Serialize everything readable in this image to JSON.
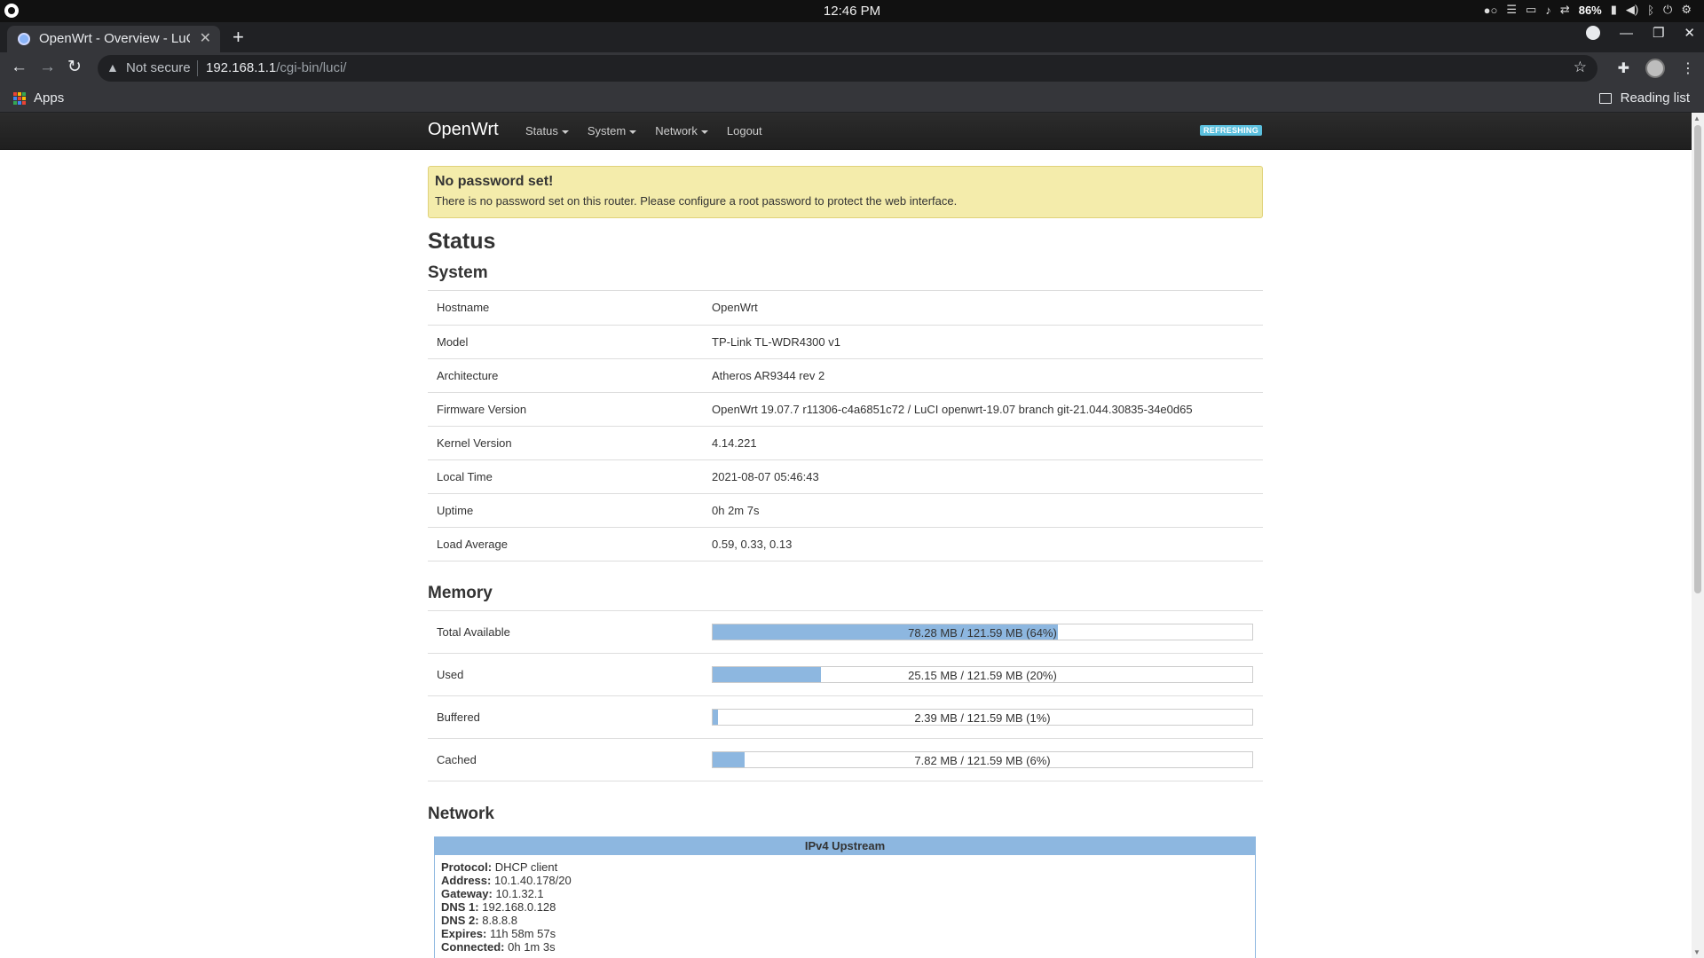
{
  "os": {
    "clock": "12:46 PM",
    "battery": "86%"
  },
  "browser": {
    "tab_title": "OpenWrt - Overview - LuCI",
    "security_label": "Not secure",
    "url_host": "192.168.1.1",
    "url_path": "/cgi-bin/luci/",
    "bookmark_apps": "Apps",
    "reading_list": "Reading list"
  },
  "navbar": {
    "brand": "OpenWrt",
    "menu": [
      "Status",
      "System",
      "Network",
      "Logout"
    ],
    "badge": "REFRESHING"
  },
  "alert": {
    "title": "No password set!",
    "message": "There is no password set on this router. Please configure a root password to protect the web interface."
  },
  "page_title": "Status",
  "system": {
    "heading": "System",
    "rows": [
      {
        "key": "Hostname",
        "value": "OpenWrt"
      },
      {
        "key": "Model",
        "value": "TP-Link TL-WDR4300 v1"
      },
      {
        "key": "Architecture",
        "value": "Atheros AR9344 rev 2"
      },
      {
        "key": "Firmware Version",
        "value": "OpenWrt 19.07.7 r11306-c4a6851c72 / LuCI openwrt-19.07 branch git-21.044.30835-34e0d65"
      },
      {
        "key": "Kernel Version",
        "value": "4.14.221"
      },
      {
        "key": "Local Time",
        "value": "2021-08-07 05:46:43"
      },
      {
        "key": "Uptime",
        "value": "0h 2m 7s"
      },
      {
        "key": "Load Average",
        "value": "0.59, 0.33, 0.13"
      }
    ]
  },
  "memory": {
    "heading": "Memory",
    "rows": [
      {
        "key": "Total Available",
        "label": "78.28 MB / 121.59 MB (64%)",
        "percent": 64
      },
      {
        "key": "Used",
        "label": "25.15 MB / 121.59 MB (20%)",
        "percent": 20
      },
      {
        "key": "Buffered",
        "label": "2.39 MB / 121.59 MB (1%)",
        "percent": 1
      },
      {
        "key": "Cached",
        "label": "7.82 MB / 121.59 MB (6%)",
        "percent": 6
      }
    ]
  },
  "network": {
    "heading": "Network",
    "box_title": "IPv4 Upstream",
    "fields": [
      {
        "key": "Protocol:",
        "value": "DHCP client"
      },
      {
        "key": "Address:",
        "value": "10.1.40.178/20"
      },
      {
        "key": "Gateway:",
        "value": "10.1.32.1"
      },
      {
        "key": "DNS 1:",
        "value": "192.168.0.128"
      },
      {
        "key": "DNS 2:",
        "value": "8.8.8.8"
      },
      {
        "key": "Expires:",
        "value": "11h 58m 57s"
      },
      {
        "key": "Connected:",
        "value": "0h 1m 3s"
      }
    ]
  },
  "colors": {
    "bar_fill": "#8db7e0",
    "alert_bg": "#f4ecab",
    "badge": "#5bc0de"
  }
}
